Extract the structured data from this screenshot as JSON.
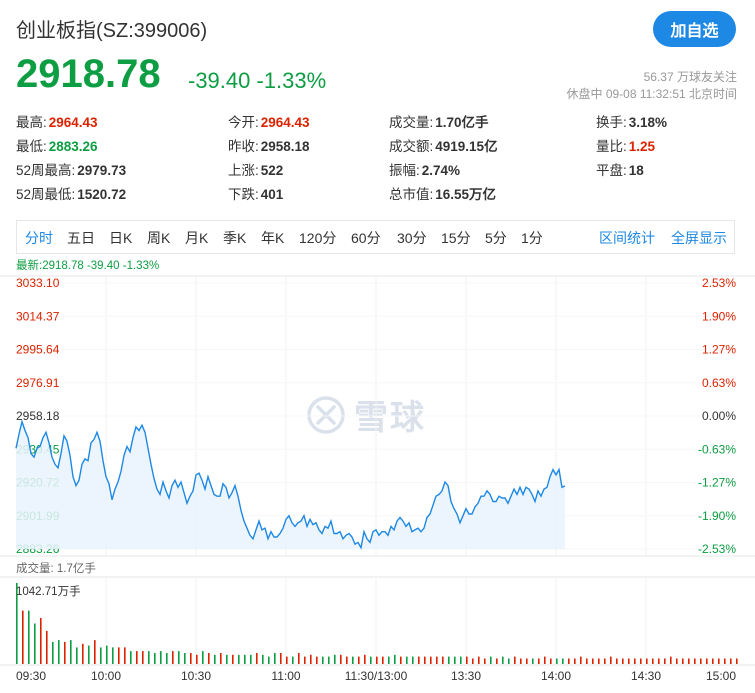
{
  "header": {
    "title": "创业板指(SZ:399006)",
    "follow_button": "加自选",
    "price": "2918.78",
    "change": "-39.40 -1.33%",
    "followers": "56.37 万球友关注",
    "status": "休盘中 09-08 11:32:51 北京时间"
  },
  "stats": [
    {
      "label": "最高:",
      "value": "2964.43",
      "color": "red"
    },
    {
      "label": "今开:",
      "value": "2964.43",
      "color": "red"
    },
    {
      "label": "成交量:",
      "value": "1.70亿手",
      "color": "black"
    },
    {
      "label": "换手:",
      "value": "3.18%",
      "color": "black"
    },
    {
      "label": "最低:",
      "value": "2883.26",
      "color": "green"
    },
    {
      "label": "昨收:",
      "value": "2958.18",
      "color": "black"
    },
    {
      "label": "成交额:",
      "value": "4919.15亿",
      "color": "black"
    },
    {
      "label": "量比:",
      "value": "1.25",
      "color": "red"
    },
    {
      "label": "52周最高:",
      "value": "2979.73",
      "color": "black"
    },
    {
      "label": "上涨:",
      "value": "522",
      "color": "black"
    },
    {
      "label": "振幅:",
      "value": "2.74%",
      "color": "black"
    },
    {
      "label": "平盘:",
      "value": "18",
      "color": "black"
    },
    {
      "label": "52周最低:",
      "value": "1520.72",
      "color": "black"
    },
    {
      "label": "下跌:",
      "value": "401",
      "color": "black"
    },
    {
      "label": "总市值:",
      "value": "16.55万亿",
      "color": "black"
    }
  ],
  "tabs": [
    "分时",
    "五日",
    "日K",
    "周K",
    "月K",
    "季K",
    "年K",
    "120分",
    "60分",
    "30分",
    "15分",
    "5分",
    "1分"
  ],
  "active_tab": "分时",
  "tab_links": [
    "区间统计",
    "全屏显示"
  ],
  "chart_latest": "最新:2918.78 -39.40 -1.33%",
  "watermark": "雪球",
  "volume_label": "成交量: 1.7亿手",
  "volume_max_label": "1042.71万手",
  "colors": {
    "up": "#dd2200",
    "down": "#0d9d42",
    "accent": "#1e88e5",
    "line": "#1e88e5"
  },
  "chart_data": {
    "type": "line",
    "prev_close": 2958.18,
    "ylim": [
      2883.26,
      3033.1
    ],
    "y_ticks_left": [
      "3033.10",
      "3014.37",
      "2995.64",
      "2976.91",
      "2958.18",
      "2939.45",
      "2920.72",
      "2901.99",
      "2883.26"
    ],
    "y_ticks_right": [
      "2.53%",
      "1.90%",
      "1.27%",
      "0.63%",
      "0.00%",
      "-0.63%",
      "-1.27%",
      "-1.90%",
      "-2.53%"
    ],
    "x_ticks": [
      "09:30",
      "10:00",
      "10:30",
      "11:00",
      "11:30/13:00",
      "13:30",
      "14:00",
      "14:30",
      "15:00"
    ],
    "session_minutes": 240,
    "price": [
      2940,
      2948,
      2955,
      2950,
      2946,
      2937,
      2935,
      2940,
      2941,
      2946,
      2949,
      2943,
      2935,
      2931,
      2929,
      2937,
      2947,
      2944,
      2936,
      2924,
      2919,
      2922,
      2931,
      2934,
      2933,
      2943,
      2945,
      2949,
      2944,
      2933,
      2924,
      2920,
      2911,
      2917,
      2921,
      2927,
      2936,
      2941,
      2938,
      2946,
      2952,
      2950,
      2953,
      2949,
      2940,
      2931,
      2923,
      2917,
      2914,
      2921,
      2916,
      2912,
      2919,
      2922,
      2918,
      2921,
      2915,
      2909,
      2913,
      2916,
      2925,
      2926,
      2922,
      2917,
      2924,
      2919,
      2914,
      2913,
      2913,
      2920,
      2918,
      2912,
      2915,
      2919,
      2913,
      2905,
      2899,
      2895,
      2891,
      2889,
      2894,
      2899,
      2894,
      2895,
      2889,
      2893,
      2890,
      2890,
      2892,
      2895,
      2900,
      2902,
      2898,
      2896,
      2898,
      2899,
      2902,
      2896,
      2900,
      2897,
      2898,
      2894,
      2892,
      2896,
      2895,
      2899,
      2892,
      2892,
      2893,
      2889,
      2891,
      2892,
      2890,
      2886,
      2887,
      2884,
      2893,
      2889,
      2887,
      2893,
      2894,
      2891,
      2893,
      2893,
      2891,
      2896,
      2894,
      2899,
      2901,
      2899,
      2896,
      2898,
      2893,
      2894,
      2895,
      2893,
      2895,
      2901,
      2903,
      2908,
      2913,
      2914,
      2916,
      2921,
      2919,
      2910,
      2906,
      2903,
      2898,
      2902,
      2906,
      2903,
      2903,
      2907,
      2909,
      2913,
      2913,
      2916,
      2914,
      2910,
      2910,
      2913,
      2912,
      2912,
      2909,
      2913,
      2917,
      2914,
      2918,
      2914,
      2918,
      2917,
      2914,
      2910,
      2916,
      2913,
      2917,
      2918,
      2924,
      2928,
      2925,
      2928,
      2918,
      2918.78
    ],
    "volume": [
      44,
      29,
      29,
      22,
      25,
      18,
      12,
      13,
      12,
      13,
      9,
      11,
      10,
      13,
      9,
      10,
      9,
      9,
      9,
      7,
      7,
      7,
      7,
      6,
      7,
      6,
      7,
      7,
      6,
      6,
      5,
      7,
      6,
      5,
      6,
      5,
      5,
      5,
      5,
      5,
      6,
      5,
      4,
      6,
      6,
      4,
      4,
      6,
      4,
      5,
      4,
      4,
      4,
      5,
      5,
      4,
      4,
      4,
      5,
      4,
      4,
      4,
      4,
      5,
      4,
      4,
      4,
      4,
      4,
      4,
      4,
      4,
      4,
      4,
      4,
      4,
      3,
      4,
      3,
      4,
      3,
      4,
      3,
      4,
      3,
      3,
      3,
      3,
      4,
      3,
      3,
      3,
      3,
      3,
      4,
      3,
      3,
      3,
      3,
      4,
      3,
      3,
      3,
      3,
      3,
      3,
      3,
      3,
      3,
      4,
      3,
      3,
      3,
      3,
      3,
      3,
      3,
      3,
      3,
      3,
      3
    ]
  }
}
